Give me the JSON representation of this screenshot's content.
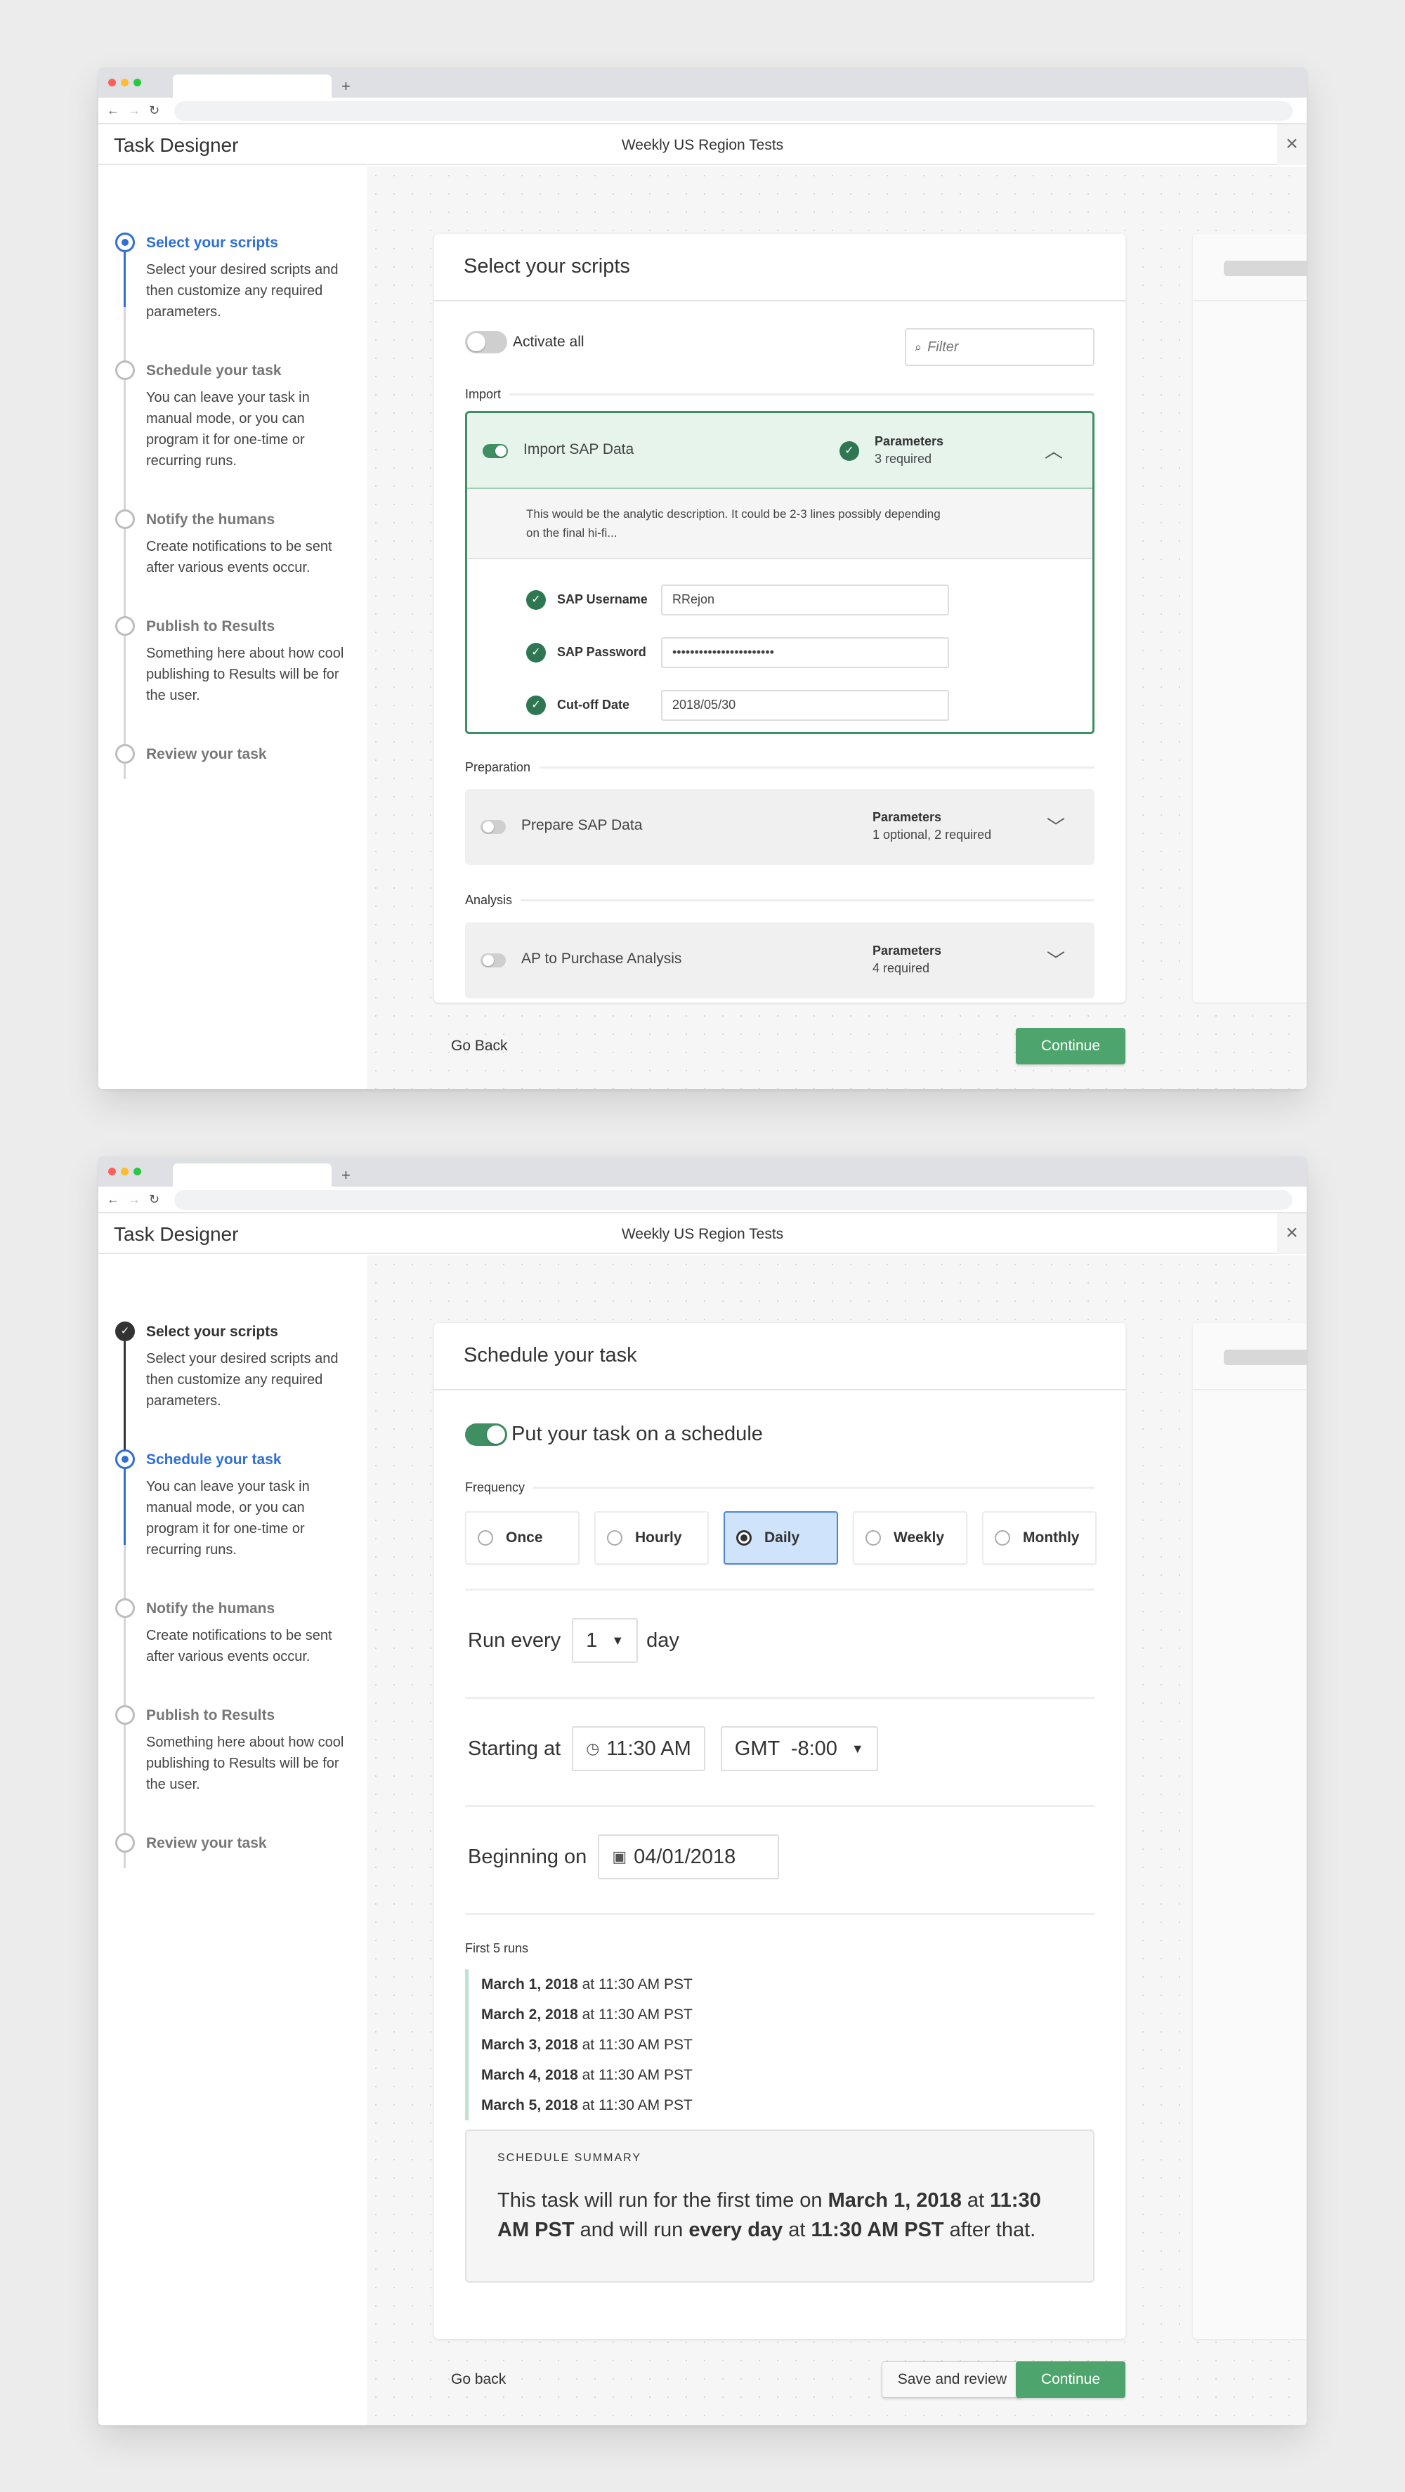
{
  "app": {
    "title": "Task Designer",
    "task_name": "Weekly US Region Tests",
    "close_icon": "close-icon"
  },
  "browser": {
    "new_tab": "+",
    "back": "←",
    "forward": "→",
    "reload": "↻"
  },
  "steps": [
    {
      "title": "Select your scripts",
      "desc": "Select your desired scripts and then customize any required parameters."
    },
    {
      "title": "Schedule your task",
      "desc": "You can leave your task in manual mode, or you can program it for one-time or recurring runs."
    },
    {
      "title": "Notify the humans",
      "desc": "Create notifications to be sent after various events occur."
    },
    {
      "title": "Publish to Results",
      "desc": "Something here about how cool publishing to Results will be for the user."
    },
    {
      "title": "Review your task",
      "desc": ""
    }
  ],
  "screen1": {
    "card_title": "Select your scripts",
    "activate_all": {
      "label": "Activate all",
      "on": false
    },
    "filter": {
      "placeholder": "Filter",
      "value": ""
    },
    "sections": [
      {
        "label": "Import",
        "scripts": [
          {
            "name": "Import SAP Data",
            "on": true,
            "expanded": true,
            "params_title": "Parameters",
            "params_sub": "3 required",
            "params_complete": true,
            "description": "This would be the analytic description. It could be 2-3 lines possibly depending on the final hi-fi...",
            "fields": [
              {
                "label": "SAP Username",
                "value": "RRejon"
              },
              {
                "label": "SAP Password",
                "value": "•••••••••••••••••••••••"
              },
              {
                "label": "Cut-off Date",
                "value": "2018/05/30"
              }
            ]
          }
        ]
      },
      {
        "label": "Preparation",
        "scripts": [
          {
            "name": "Prepare SAP Data",
            "on": false,
            "expanded": false,
            "params_title": "Parameters",
            "params_sub": "1 optional, 2 required"
          }
        ]
      },
      {
        "label": "Analysis",
        "scripts": [
          {
            "name": "AP to Purchase Analysis",
            "on": false,
            "expanded": false,
            "params_title": "Parameters",
            "params_sub": "4 required"
          }
        ]
      }
    ],
    "go_back": "Go Back",
    "continue": "Continue"
  },
  "screen2": {
    "card_title": "Schedule your task",
    "schedule_toggle": {
      "label": "Put your task on a schedule",
      "on": true
    },
    "frequency_label": "Frequency",
    "frequency_options": [
      "Once",
      "Hourly",
      "Daily",
      "Weekly",
      "Monthly"
    ],
    "frequency_selected": "Daily",
    "run_every": {
      "label": "Run every",
      "value": "1",
      "unit": "day"
    },
    "starting_at": {
      "label": "Starting at",
      "time": "11:30 AM",
      "timezone": "GMT  -8:00"
    },
    "beginning_on": {
      "label": "Beginning on",
      "date": "04/01/2018"
    },
    "runs_title": "First 5 runs",
    "runs": [
      {
        "date": "March 1, 2018",
        "time": "at 11:30 AM PST"
      },
      {
        "date": "March 2, 2018",
        "time": "at 11:30 AM PST"
      },
      {
        "date": "March 3, 2018",
        "time": "at 11:30 AM PST"
      },
      {
        "date": "March 4, 2018",
        "time": "at 11:30 AM PST"
      },
      {
        "date": "March 5, 2018",
        "time": "at 11:30 AM PST"
      }
    ],
    "summary": {
      "title": "SCHEDULE SUMMARY",
      "t1": "This task will run for the first time on ",
      "b1": "March 1, 2018",
      "t2": " at ",
      "b2": "11:30 AM PST",
      "t3": " and will run ",
      "b3": "every day",
      "t4": " at ",
      "b4": "11:30 AM PST",
      "t5": " after that."
    },
    "go_back": "Go back",
    "save_review": "Save and review",
    "continue": "Continue"
  },
  "colors": {
    "accent_blue": "#2f6fd6",
    "success_green": "#4da56d",
    "dark_green": "#2e7752",
    "selected_bg": "#cfe3fb"
  }
}
